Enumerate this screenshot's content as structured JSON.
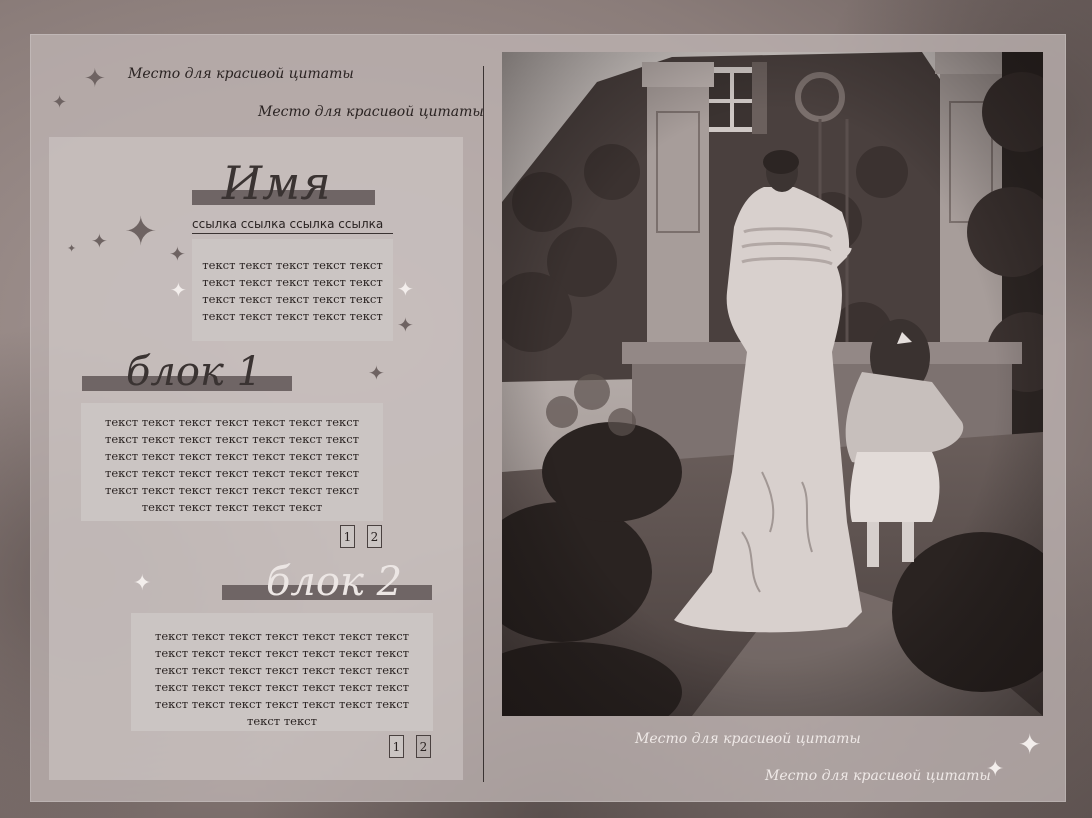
{
  "quotes": {
    "top_1": "Место для красивой цитаты",
    "top_2": "Место для красивой цитаты",
    "bottom_1": "Место для красивой цитаты",
    "bottom_2": "Место для красивой цитаты"
  },
  "profile": {
    "name": "Имя",
    "links": "ссылка ссылка ссылка ссылка",
    "bio": "текст текст текст текст текст текст текст текст текст текст текст текст текст текст текст текст текст текст текст текст"
  },
  "block1": {
    "title": "блок 1",
    "text": "текст текст текст текст текст текст текст текст текст текст текст текст текст текст текст текст текст текст текст текст текст текст текст текст текст текст текст текст текст текст текст текст текст текст текст текст текст текст текст текст",
    "pages": [
      "1",
      "2"
    ]
  },
  "block2": {
    "title": "блок 2",
    "text": "текст текст текст текст текст текст текст текст текст текст текст текст текст текст текст текст текст текст текст текст текст текст текст текст текст текст текст текст текст текст текст текст текст текст текст текст текст",
    "pages": [
      "1",
      "2"
    ]
  },
  "icons": {
    "sparkle": "✦"
  },
  "colors": {
    "card": "#beb4b2",
    "heading_bar": "#6f6565",
    "text": "#2a2322",
    "textbox": "#cbc5c3"
  }
}
